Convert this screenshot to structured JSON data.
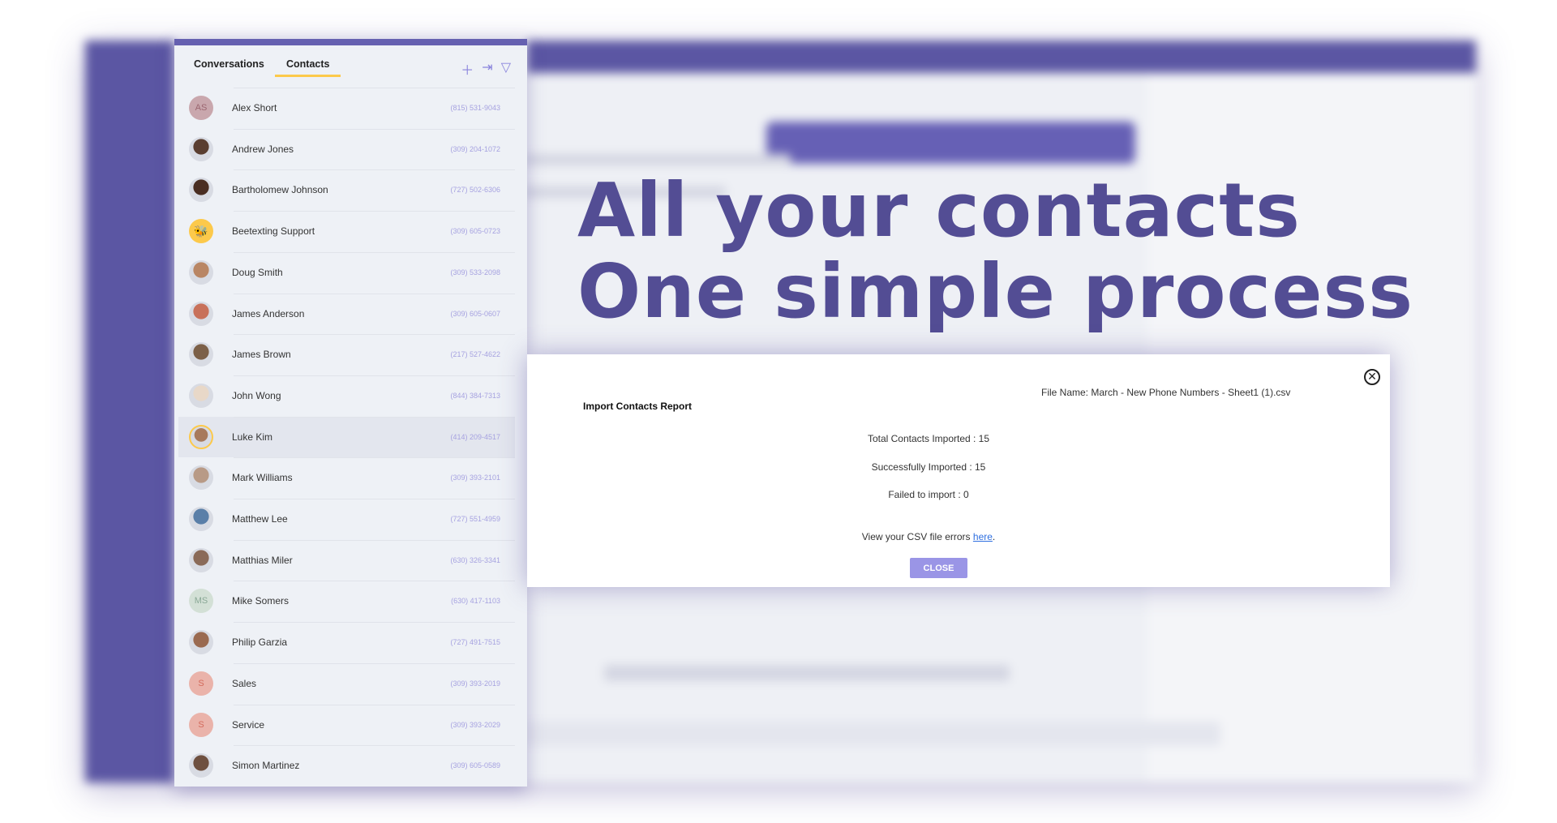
{
  "tabs": [
    {
      "label": "Conversations"
    },
    {
      "label": "Contacts",
      "active": true
    }
  ],
  "toolbar_icons": [
    "plus-icon",
    "export-icon",
    "filter-icon"
  ],
  "contacts": [
    {
      "name": "Alex Short",
      "phone": "(815) 531-9043",
      "initials": "AS",
      "color": "#c9a7ad",
      "text": "#9b6670"
    },
    {
      "name": "Andrew Jones",
      "phone": "(309) 204-1072",
      "photo": "#5a3e30"
    },
    {
      "name": "Bartholomew Johnson",
      "phone": "(727) 502-6306",
      "photo": "#4a2e22"
    },
    {
      "name": "Beetexting Support",
      "phone": "(309) 605-0723",
      "bee": true,
      "color": "#fcc94b"
    },
    {
      "name": "Doug Smith",
      "phone": "(309) 533-2098",
      "photo": "#b98664"
    },
    {
      "name": "James Anderson",
      "phone": "(309) 605-0607",
      "photo": "#c8715a"
    },
    {
      "name": "James Brown",
      "phone": "(217) 527-4622",
      "photo": "#7c6048"
    },
    {
      "name": "John Wong",
      "phone": "(844) 384-7313",
      "photo": "#e8d8c8"
    },
    {
      "name": "Luke Kim",
      "phone": "(414) 209-4517",
      "photo": "#a87a5c",
      "selected": true
    },
    {
      "name": "Mark Williams",
      "phone": "(309) 393-2101",
      "photo": "#b89a86"
    },
    {
      "name": "Matthew Lee",
      "phone": "(727) 551-4959",
      "photo": "#5a7fa8"
    },
    {
      "name": "Matthias Miler",
      "phone": "(630) 326-3341",
      "photo": "#8a6a58"
    },
    {
      "name": "Mike Somers",
      "phone": "(630) 417-1103",
      "initials": "MS",
      "color": "#d3e0d6",
      "text": "#8aa896"
    },
    {
      "name": "Philip Garzia",
      "phone": "(727) 491-7515",
      "photo": "#9a6a50"
    },
    {
      "name": "Sales",
      "phone": "(309) 393-2019",
      "initials": "S",
      "color": "#eab3aa",
      "text": "#d36b5c"
    },
    {
      "name": "Service",
      "phone": "(309) 393-2029",
      "initials": "S",
      "color": "#eab3aa",
      "text": "#d36b5c"
    },
    {
      "name": "Simon Martinez",
      "phone": "(309) 605-0589",
      "photo": "#6e5040"
    }
  ],
  "headline": {
    "line1": "All your contacts",
    "line2": "One simple process"
  },
  "modal": {
    "title": "Import Contacts Report",
    "file_name": "File Name: March - New Phone Numbers - Sheet1 (1).csv",
    "total": "Total Contacts Imported : 15",
    "success": "Successfully Imported : 15",
    "failed": "Failed to import : 0",
    "csv_text": "View your CSV file errors ",
    "csv_link": "here",
    "close_label": "CLOSE"
  },
  "colors": {
    "brand": "#5b56a3",
    "accent": "#fcc94b",
    "headline": "#534d94",
    "button": "#9a95e6"
  }
}
